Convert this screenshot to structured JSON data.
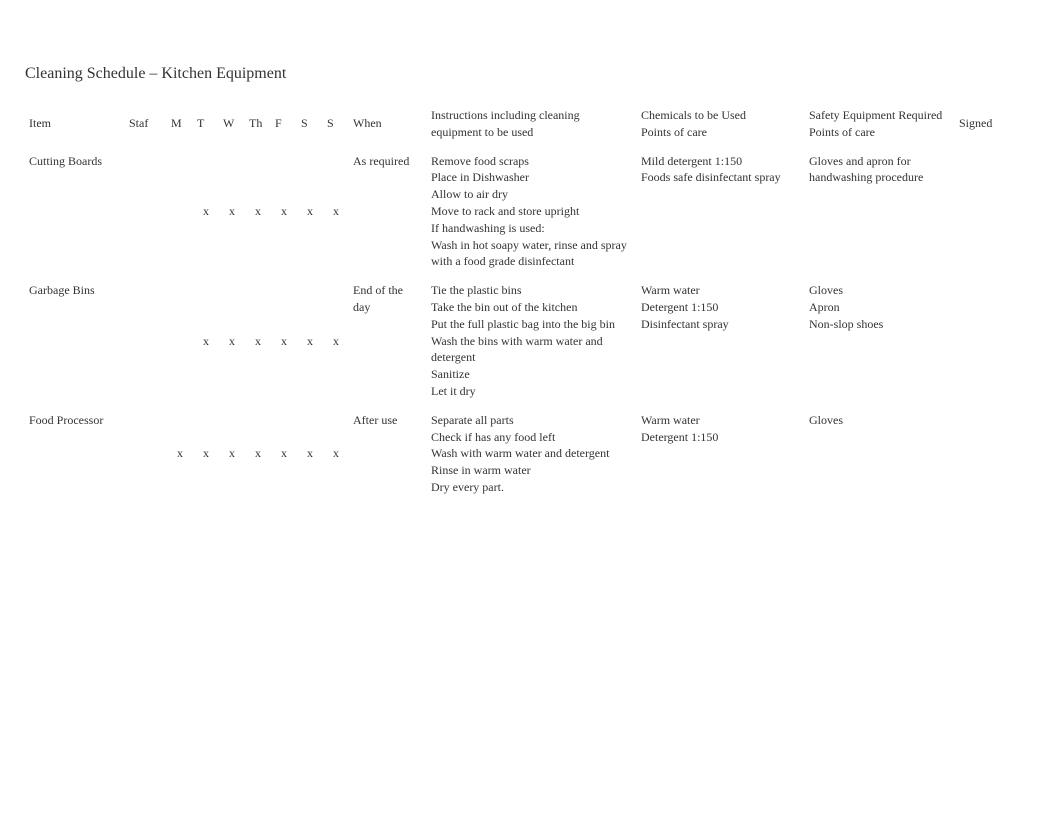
{
  "title": "Cleaning Schedule – Kitchen Equipment",
  "headers": {
    "item": "Item",
    "staf": "Staf",
    "m": "M",
    "t": "T",
    "w": "W",
    "th": "Th",
    "f": "F",
    "s1": "S",
    "s2": "S",
    "when": "When",
    "instructions": "Instructions including cleaning equipment to be used",
    "chemicals": "Chemicals to be Used\nPoints of care",
    "safety": "Safety Equipment Required\nPoints of care",
    "signed": "Signed"
  },
  "rows": [
    {
      "item": "Cutting Boards",
      "staf": "",
      "days": [
        "",
        "x",
        "x",
        "x",
        "x",
        "x",
        "x"
      ],
      "when": "As required",
      "instructions": "Remove food scraps\nPlace in Dishwasher\nAllow to air dry\nMove to rack and store upright\n \nIf handwashing is used:\nWash in hot soapy water, rinse and spray with a food grade disinfectant",
      "chemicals": "Mild detergent 1:150\nFoods safe disinfectant spray",
      "safety": "Gloves and apron for handwashing procedure",
      "signed": ""
    },
    {
      "item": "Garbage Bins",
      "staf": "",
      "days": [
        "",
        "x",
        "x",
        "x",
        "x",
        "x",
        "x"
      ],
      "when": "End of the day",
      "instructions": "Tie the plastic bins\nTake the bin out of the kitchen\nPut the full plastic bag into the big bin\nWash the bins with warm water and detergent\nSanitize\nLet it dry",
      "chemicals": "Warm water\nDetergent 1:150\nDisinfectant spray",
      "safety": "Gloves\nApron\nNon-slop shoes",
      "signed": ""
    },
    {
      "item": "Food Processor",
      "staf": "",
      "days": [
        "x",
        "x",
        "x",
        "x",
        "x",
        "x",
        "x"
      ],
      "when": "After use",
      "instructions": "Separate all parts\nCheck if has any food left\nWash with warm water and detergent\nRinse in warm water\nDry every part.",
      "chemicals": "Warm water\nDetergent 1:150",
      "safety": "Gloves",
      "signed": ""
    }
  ]
}
